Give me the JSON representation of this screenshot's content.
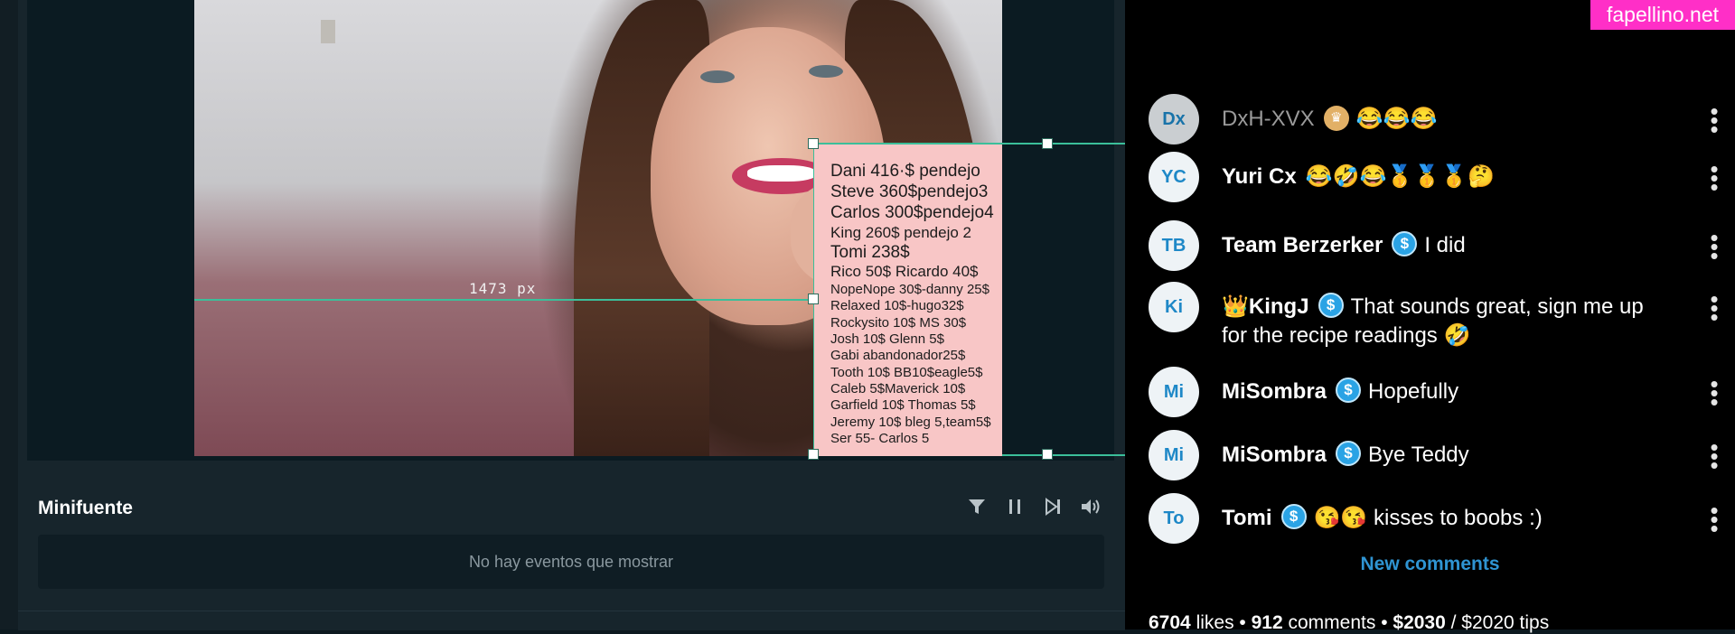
{
  "watermark": "fapellino.net",
  "preview": {
    "measurement_label": "1473 px",
    "tips_list": [
      {
        "text": "Dani 416·$ pendejo",
        "size": "big"
      },
      {
        "text": "Steve 360$pendejo3",
        "size": "big"
      },
      {
        "text": "Carlos 300$pendejo4",
        "size": "big"
      },
      {
        "text": "King 260$ pendejo 2",
        "size": "med"
      },
      {
        "text": "Tomi 238$",
        "size": "big"
      },
      {
        "text": "Rico 50$ Ricardo 40$",
        "size": "med"
      },
      {
        "text": "NopeNope 30$-danny 25$",
        "size": "sm"
      },
      {
        "text": "Relaxed 10$-hugo32$",
        "size": "sm"
      },
      {
        "text": "Rockysito 10$ MS 30$",
        "size": "sm"
      },
      {
        "text": "Josh 10$ Glenn 5$",
        "size": "sm"
      },
      {
        "text": "Gabi abandonador25$",
        "size": "sm"
      },
      {
        "text": "Tooth 10$ BB10$eagle5$",
        "size": "sm"
      },
      {
        "text": "Caleb 5$Maverick 10$",
        "size": "sm"
      },
      {
        "text": "Garfield 10$ Thomas 5$",
        "size": "sm"
      },
      {
        "text": "Jeremy 10$ bleg 5,team5$",
        "size": "sm"
      },
      {
        "text": "Ser 55- Carlos 5",
        "size": "sm"
      }
    ]
  },
  "minifuente": {
    "title": "Minifuente",
    "tools": [
      "filter-icon",
      "pause-icon",
      "skip-next-icon",
      "volume-icon"
    ],
    "empty_message": "No hay eventos que mostrar"
  },
  "comments": [
    {
      "initials": "Dx",
      "name": "DxH-XVX",
      "badge": "crown",
      "text": "😂😂😂",
      "faded": true
    },
    {
      "initials": "YC",
      "name": "Yuri Cx",
      "badge": "",
      "text": "😂🤣😂🥇🥇🥇🤔",
      "faded": false
    },
    {
      "initials": "TB",
      "name": "Team Berzerker",
      "badge": "tip",
      "text": "I did",
      "faded": false
    },
    {
      "initials": "Ki",
      "name": "👑KingJ",
      "badge": "tip",
      "text": "That sounds great, sign me up for the recipe readings 🤣",
      "faded": false
    },
    {
      "initials": "Mi",
      "name": "MiSombra",
      "badge": "tip",
      "text": "Hopefully",
      "faded": false
    },
    {
      "initials": "Mi",
      "name": "MiSombra",
      "badge": "tip",
      "text": "Bye Teddy",
      "faded": false
    },
    {
      "initials": "To",
      "name": "Tomi",
      "badge": "tip",
      "text": "😘😘 kisses to boobs :)",
      "faded": false
    }
  ],
  "new_comments_label": "New comments",
  "stats": {
    "likes": "6704",
    "likes_label": "likes",
    "comments": "912",
    "comments_label": "comments",
    "tips": "$2030",
    "tips_goal": "/ $2020 tips"
  },
  "colors": {
    "accent_green": "#3bbf9a",
    "link_blue": "#2f94d2",
    "tip_blue": "#2aa3e5",
    "watermark_pink": "#ff2fc7"
  }
}
